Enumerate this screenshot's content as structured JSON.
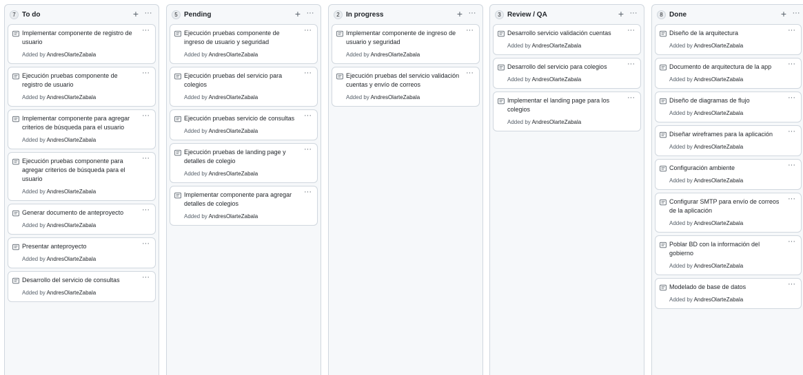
{
  "columns": [
    {
      "count": "7",
      "title": "To do",
      "cards": [
        {
          "title": "Implementar componente de registro de usuario",
          "added_prefix": "Added by",
          "author": "AndresOlarteZabala"
        },
        {
          "title": "Ejecución pruebas componente de registro de usuario",
          "added_prefix": "Added by",
          "author": "AndresOlarteZabala"
        },
        {
          "title": "Implementar componente para agregar criterios de búsqueda para el usuario",
          "added_prefix": "Added by",
          "author": "AndresOlarteZabala"
        },
        {
          "title": "Ejecución pruebas componente para agregar criterios de búsqueda para el usuario",
          "added_prefix": "Added by",
          "author": "AndresOlarteZabala"
        },
        {
          "title": "Generar documento de anteproyecto",
          "added_prefix": "Added by",
          "author": "AndresOlarteZabala"
        },
        {
          "title": "Presentar anteproyecto",
          "added_prefix": "Added by",
          "author": "AndresOlarteZabala"
        },
        {
          "title": "Desarrollo del servicio de consultas",
          "added_prefix": "Added by",
          "author": "AndresOlarteZabala"
        }
      ]
    },
    {
      "count": "5",
      "title": "Pending",
      "cards": [
        {
          "title": "Ejecución pruebas componente de ingreso de usuario y seguridad",
          "added_prefix": "Added by",
          "author": "AndresOlarteZabala"
        },
        {
          "title": "Ejecución pruebas del servicio para colegios",
          "added_prefix": "Added by",
          "author": "AndresOlarteZabala"
        },
        {
          "title": "Ejecución pruebas servicio de consultas",
          "added_prefix": "Added by",
          "author": "AndresOlarteZabala"
        },
        {
          "title": "Ejecución pruebas de landing page y detalles de colegio",
          "added_prefix": "Added by",
          "author": "AndresOlarteZabala"
        },
        {
          "title": "Implementar componente para agregar detalles de colegios",
          "added_prefix": "Added by",
          "author": "AndresOlarteZabala"
        }
      ]
    },
    {
      "count": "2",
      "title": "In progress",
      "cards": [
        {
          "title": "Implementar componente de ingreso de usuario y seguridad",
          "added_prefix": "Added by",
          "author": "AndresOlarteZabala"
        },
        {
          "title": "Ejecución pruebas del servicio validación cuentas y envío de correos",
          "added_prefix": "Added by",
          "author": "AndresOlarteZabala"
        }
      ]
    },
    {
      "count": "3",
      "title": "Review / QA",
      "cards": [
        {
          "title": "Desarrollo servicio validación cuentas",
          "added_prefix": "Added by",
          "author": "AndresOlarteZabala"
        },
        {
          "title": "Desarrollo del servicio para colegios",
          "added_prefix": "Added by",
          "author": "AndresOlarteZabala"
        },
        {
          "title": "Implementar el landing page para los colegios",
          "added_prefix": "Added by",
          "author": "AndresOlarteZabala"
        }
      ]
    },
    {
      "count": "8",
      "title": "Done",
      "cards": [
        {
          "title": "Diseño de la arquitectura",
          "added_prefix": "Added by",
          "author": "AndresOlarteZabala"
        },
        {
          "title": "Documento de arquitectura de la app",
          "added_prefix": "Added by",
          "author": "AndresOlarteZabala"
        },
        {
          "title": "Diseño de diagramas de flujo",
          "added_prefix": "Added by",
          "author": "AndresOlarteZabala"
        },
        {
          "title": "Diseñar wireframes para la aplicación",
          "added_prefix": "Added by",
          "author": "AndresOlarteZabala"
        },
        {
          "title": "Configuración ambiente",
          "added_prefix": "Added by",
          "author": "AndresOlarteZabala"
        },
        {
          "title": "Configurar SMTP para envío de correos de la aplicación",
          "added_prefix": "Added by",
          "author": "AndresOlarteZabala"
        },
        {
          "title": "Poblar BD con la información del gobierno",
          "added_prefix": "Added by",
          "author": "AndresOlarteZabala"
        },
        {
          "title": "Modelado de base de datos",
          "added_prefix": "Added by",
          "author": "AndresOlarteZabala"
        }
      ]
    }
  ],
  "icons": {
    "add": "+",
    "menu": "···",
    "card_icon": "note-icon"
  }
}
